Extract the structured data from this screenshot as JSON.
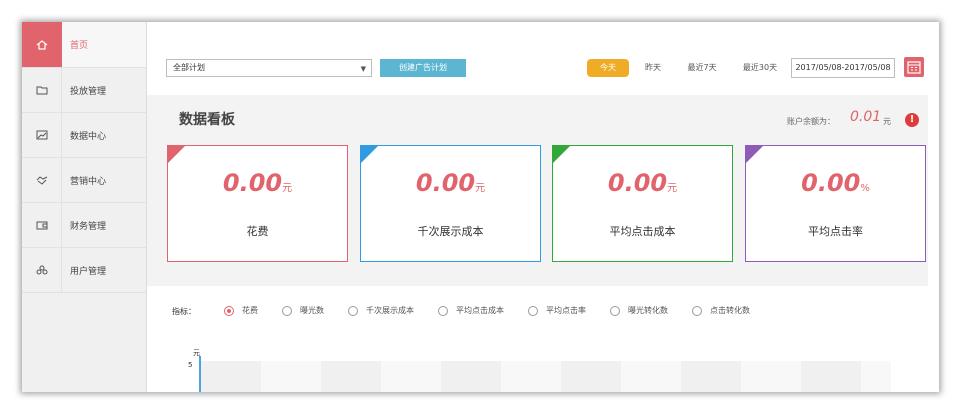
{
  "sidebar": {
    "items": [
      {
        "label": "首页",
        "icon": "home-icon",
        "active": true
      },
      {
        "label": "投放管理",
        "icon": "folder-icon"
      },
      {
        "label": "数据中心",
        "icon": "trend-chart-icon"
      },
      {
        "label": "营销中心",
        "icon": "handshake-icon"
      },
      {
        "label": "财务管理",
        "icon": "wallet-icon"
      },
      {
        "label": "用户管理",
        "icon": "users-icon"
      }
    ]
  },
  "topbar": {
    "plan_select": "全部计划",
    "create_button": "创建广告计划",
    "ranges": [
      "今天",
      "昨天",
      "最近7天",
      "最近30天"
    ],
    "active_range": "今天",
    "date_range": "2017/05/08-2017/05/08"
  },
  "dashboard": {
    "title": "数据看板",
    "balance_label": "账户余额为：",
    "balance_value": "0.01",
    "balance_unit": "元",
    "cards": [
      {
        "value": "0.00",
        "unit": "元",
        "label": "花费",
        "color": "#e1646d"
      },
      {
        "value": "0.00",
        "unit": "元",
        "label": "千次展示成本",
        "color": "#2f9be0"
      },
      {
        "value": "0.00",
        "unit": "元",
        "label": "平均点击成本",
        "color": "#33a83a"
      },
      {
        "value": "0.00",
        "unit": "%",
        "label": "平均点击率",
        "color": "#8e5cb8"
      }
    ]
  },
  "indicators": {
    "title": "指标：",
    "options": [
      "花费",
      "曝光数",
      "千次展示成本",
      "平均点击成本",
      "平均点击率",
      "曝光转化数",
      "点击转化数"
    ],
    "selected": "花费"
  },
  "chart": {
    "unit": "元",
    "y_tick": "5"
  },
  "colors": {
    "accent": "#e1646d",
    "create_button": "#5cb6d2",
    "active_range": "#f0ab27"
  }
}
